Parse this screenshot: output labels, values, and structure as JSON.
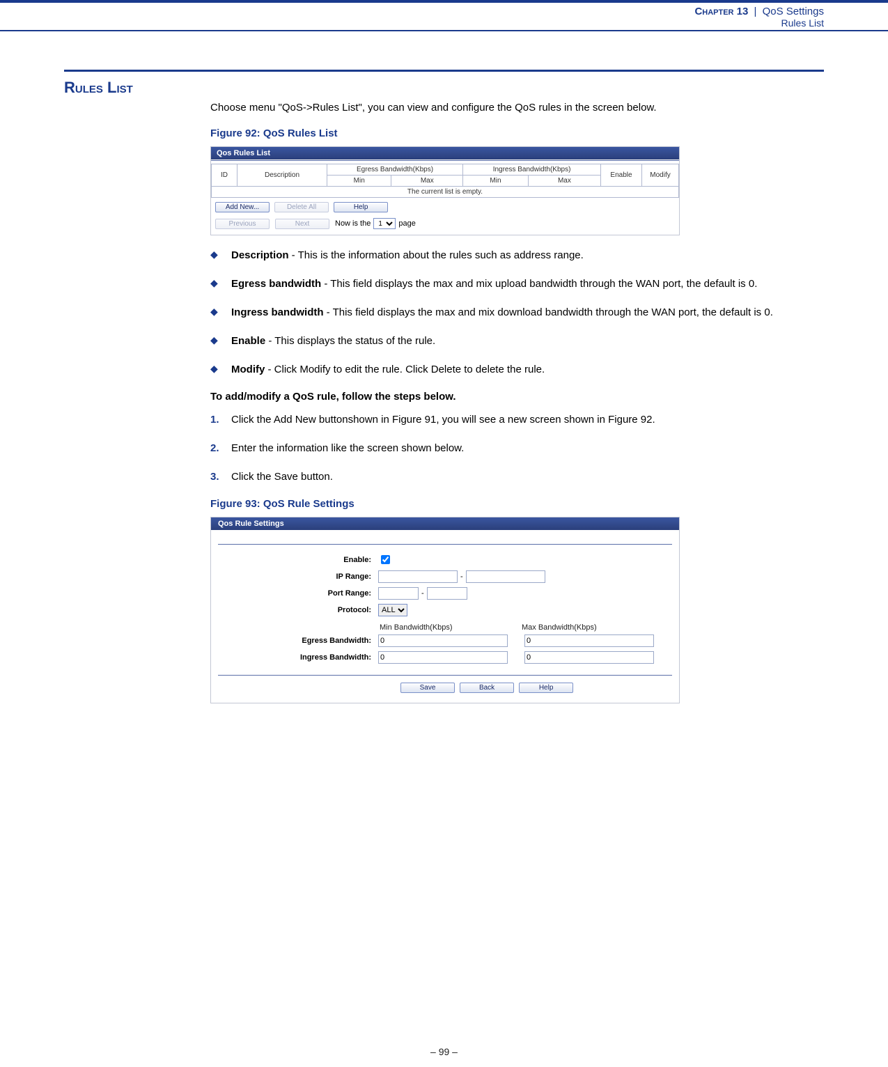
{
  "doc_header": {
    "chapter": "Chapter 13",
    "sep": "|",
    "section_group": "QoS Settings",
    "section_sub": "Rules List"
  },
  "section": {
    "title": "Rules List",
    "intro": "Choose menu \"QoS->Rules List\", you can view and configure the QoS rules in the screen below."
  },
  "fig92": {
    "caption": "Figure 92:  QoS Rules List",
    "titlebar": "Qos Rules List",
    "cols": {
      "id": "ID",
      "description": "Description",
      "egress": "Egress Bandwidth(Kbps)",
      "ingress": "Ingress Bandwidth(Kbps)",
      "min": "Min",
      "max": "Max",
      "enable": "Enable",
      "modify": "Modify"
    },
    "empty_text": "The current list is empty.",
    "buttons": {
      "add_new": "Add New...",
      "delete_all": "Delete All",
      "help": "Help",
      "previous": "Previous",
      "next": "Next"
    },
    "pager": {
      "label_prefix": "Now is the",
      "page_value": "1",
      "label_suffix": "page"
    }
  },
  "bullets": [
    {
      "term": "Description",
      "rest": " - This is the information about the rules such as address range."
    },
    {
      "term": "Egress bandwidth",
      "rest": " - This field displays the max and mix upload bandwidth through the WAN port, the default is 0."
    },
    {
      "term": "Ingress bandwidth",
      "rest": " - This field displays the max and mix download bandwidth through the WAN port, the default is 0."
    },
    {
      "term": "Enable",
      "rest": " - This displays the status of the rule."
    },
    {
      "term": "Modify",
      "rest": " - Click Modify to edit the rule. Click Delete to delete the rule."
    }
  ],
  "steps_intro": "To add/modify a QoS rule, follow the steps below.",
  "steps": [
    "Click the Add New buttonshown in Figure 91, you will see a new screen shown in Figure 92.",
    "Enter the information like the screen shown below.",
    "Click the Save button."
  ],
  "fig93": {
    "caption": "Figure 93:  QoS Rule Settings",
    "titlebar": "Qos Rule Settings",
    "labels": {
      "enable": "Enable:",
      "ip_range": "IP Range:",
      "port_range": "Port Range:",
      "protocol": "Protocol:",
      "egress_bw": "Egress Bandwidth:",
      "ingress_bw": "Ingress Bandwidth:",
      "min_bw": "Min Bandwidth(Kbps)",
      "max_bw": "Max Bandwidth(Kbps)"
    },
    "values": {
      "protocol_selected": "ALL",
      "egress_min": "0",
      "egress_max": "0",
      "ingress_min": "0",
      "ingress_max": "0"
    },
    "buttons": {
      "save": "Save",
      "back": "Back",
      "help": "Help"
    }
  },
  "footer": "–  99  –"
}
